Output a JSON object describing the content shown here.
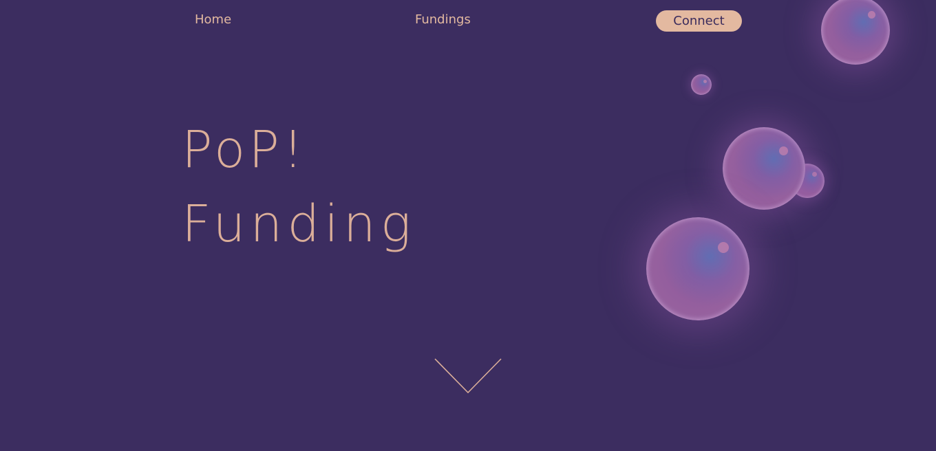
{
  "nav": {
    "home_label": "Home",
    "fundings_label": "Fundings",
    "connect_label": "Connect"
  },
  "hero": {
    "line1": "PoP!",
    "line2": "Funding"
  },
  "icons": {
    "scroll_down": "chevron-down-icon"
  },
  "colors": {
    "background": "#3c2d60",
    "accent": "#e3b9a0",
    "bubble": "#96609e"
  }
}
